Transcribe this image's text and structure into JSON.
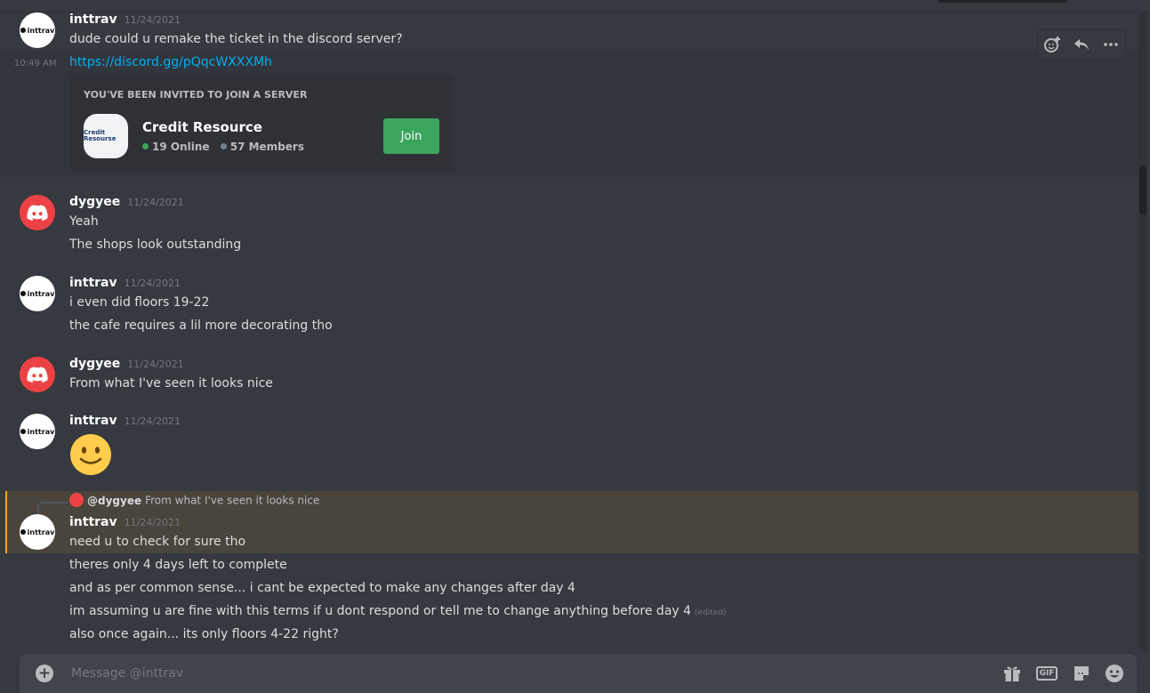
{
  "toolbar": {
    "add_reaction_icon": "add-reaction",
    "reply_icon": "reply",
    "more_icon": "more"
  },
  "messages": [
    {
      "author": "inttrav",
      "avatar_text": "inttrav",
      "timestamp": "11/24/2021",
      "lines": [
        "dude could u remake the ticket in the discord server?"
      ]
    },
    {
      "side_time": "10:49 AM",
      "link": "https://discord.gg/pQqcWXXXMh"
    },
    {
      "author": "dygyee",
      "timestamp": "11/24/2021",
      "lines": [
        "Yeah",
        "The shops look outstanding"
      ]
    },
    {
      "author": "inttrav",
      "avatar_text": "inttrav",
      "timestamp": "11/24/2021",
      "lines": [
        "i even did floors 19-22",
        "the cafe requires a lil more decorating tho"
      ]
    },
    {
      "author": "dygyee",
      "timestamp": "11/24/2021",
      "lines": [
        "From what I've seen it looks nice"
      ]
    },
    {
      "author": "inttrav",
      "avatar_text": "inttrav",
      "timestamp": "11/24/2021",
      "emoji": "slightly-smiling-face"
    },
    {
      "author": "inttrav",
      "avatar_text": "inttrav",
      "timestamp": "11/24/2021",
      "reply": {
        "name": "@dygyee",
        "text": "From what I've seen it looks nice"
      },
      "lines": [
        "need u to check for sure tho",
        "theres only 4 days left to complete",
        "and as per common sense... i cant be expected to make any changes after day 4",
        "im assuming u are fine with this terms if u dont respond or tell me to change anything before day 4",
        "also once again... its only floors 4-22 right?"
      ],
      "edited": "(edited)"
    }
  ],
  "invite": {
    "header": "YOU'VE BEEN INVITED TO JOIN A SERVER",
    "icon_text": "Credit Resourse",
    "server_name": "Credit Resource",
    "online": "19 Online",
    "members": "57 Members",
    "join_label": "Join"
  },
  "composer": {
    "placeholder": "Message @inttrav"
  },
  "colors": {
    "bg": "#36393f",
    "accent_blue": "#00aff4",
    "green": "#3ba55d",
    "mention": "#faa81a"
  }
}
